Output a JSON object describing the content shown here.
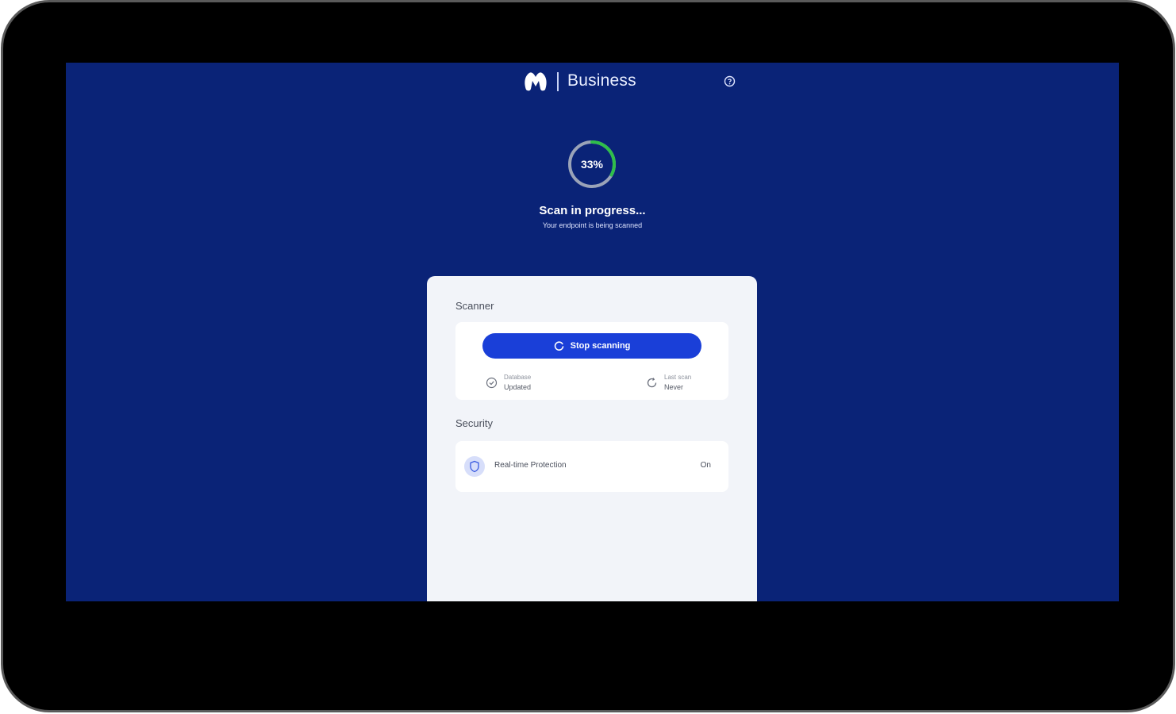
{
  "header": {
    "brand": "Business",
    "logo_icon": "malwarebytes-logo-icon",
    "help_icon": "help-circle-icon"
  },
  "scan": {
    "percent_label": "33%",
    "progress_fraction": 0.33,
    "title": "Scan in progress...",
    "subtitle": "Your endpoint is being scanned"
  },
  "scanner": {
    "section_label": "Scanner",
    "stop_button_label": "Stop scanning",
    "database_key": "Database",
    "database_value": "Updated",
    "last_scan_key": "Last scan",
    "last_scan_value": "Never"
  },
  "security": {
    "section_label": "Security",
    "items": [
      {
        "label": "Real-time Protection",
        "status": "On",
        "icon": "shield-icon"
      }
    ]
  },
  "colors": {
    "background": "#0a2377",
    "accent": "#1a3fd8",
    "progress": "#2fbf4a",
    "panel": "#f2f4f9"
  }
}
